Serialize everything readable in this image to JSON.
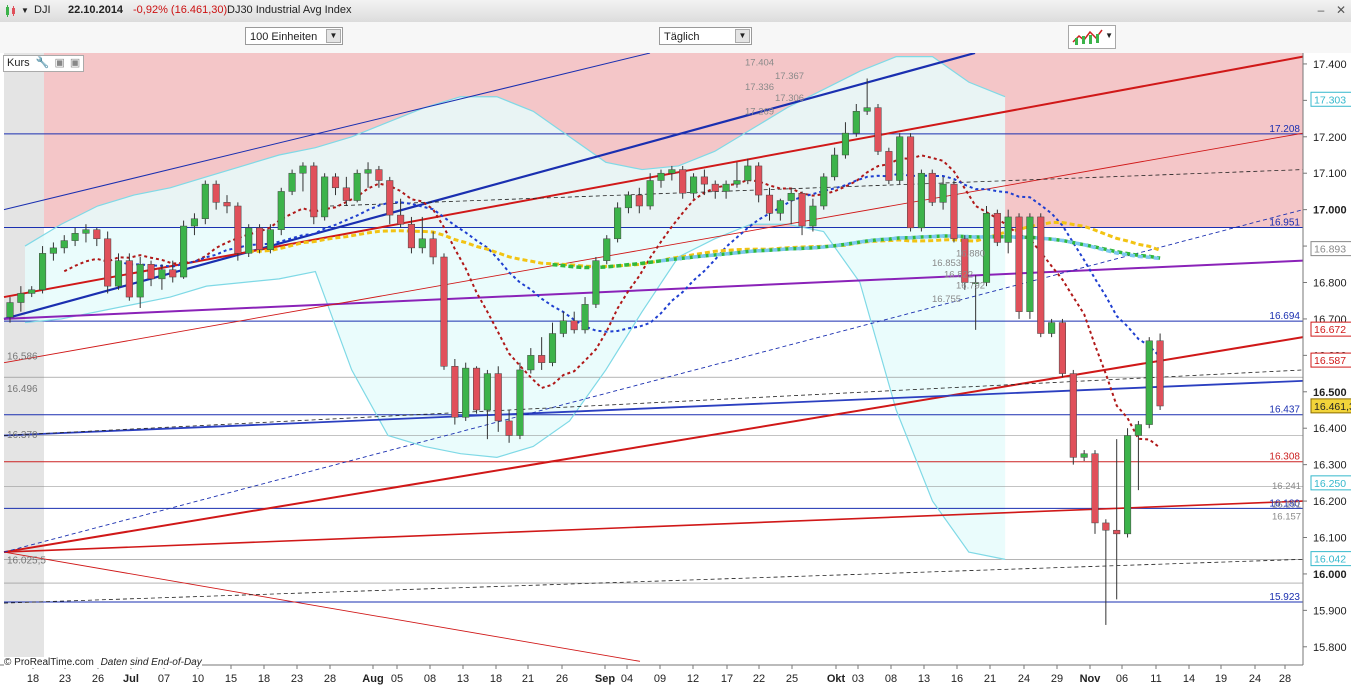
{
  "window": {
    "symbol": "DJI",
    "date": "22.10.2014",
    "change": "-0,92% (16.461,30)",
    "name": "DJ30 Industrial Avg Index"
  },
  "toolbar": {
    "units_select": "100 Einheiten",
    "period_select": "Täglich"
  },
  "panel": {
    "label": "Kurs"
  },
  "footer": {
    "copyright": "© ProRealTime.com",
    "notice": "Daten sind End-of-Day"
  },
  "colors": {
    "bull": "#3cb34a",
    "bear": "#e0505a",
    "resistance_zone": "#f4c6c8",
    "bollinger_fill": "#e6fbfb",
    "bollinger_line": "#7fd9e6",
    "price_tag": "#f2d43a"
  },
  "chart_data": {
    "type": "candlestick",
    "ylim": [
      15750,
      17430
    ],
    "y_ticks": [
      {
        "value": 17400,
        "label": "17.400"
      },
      {
        "value": 17300,
        "label": "17.300"
      },
      {
        "value": 17200,
        "label": "17.200"
      },
      {
        "value": 17100,
        "label": "17.100"
      },
      {
        "value": 17000,
        "label": "17.000"
      },
      {
        "value": 16900,
        "label": "16.900"
      },
      {
        "value": 16800,
        "label": "16.800"
      },
      {
        "value": 16700,
        "label": "16.700"
      },
      {
        "value": 16600,
        "label": "16.600"
      },
      {
        "value": 16500,
        "label": "16.500"
      },
      {
        "value": 16400,
        "label": "16.400"
      },
      {
        "value": 16300,
        "label": "16.300"
      },
      {
        "value": 16200,
        "label": "16.200"
      },
      {
        "value": 16100,
        "label": "16.100"
      },
      {
        "value": 16000,
        "label": "16.000"
      },
      {
        "value": 15900,
        "label": "15.900"
      },
      {
        "value": 15800,
        "label": "15.800"
      }
    ],
    "bold_ticks": [
      "17.000",
      "16.500",
      "16.000"
    ],
    "x_labels": [
      "18",
      "23",
      "26",
      "Jul",
      "07",
      "10",
      "15",
      "18",
      "23",
      "28",
      "Aug",
      "05",
      "08",
      "13",
      "18",
      "21",
      "26",
      "Sep",
      "04",
      "09",
      "12",
      "17",
      "22",
      "25",
      "Okt",
      "03",
      "08",
      "13",
      "16",
      "21",
      "24",
      "29",
      "Nov",
      "06",
      "11",
      "14",
      "19",
      "24",
      "28"
    ],
    "month_labels": [
      "Jul",
      "Aug",
      "Sep",
      "Okt",
      "Nov"
    ],
    "candles": [
      {
        "o": 16705,
        "h": 16760,
        "l": 16690,
        "c": 16745
      },
      {
        "o": 16745,
        "h": 16790,
        "l": 16720,
        "c": 16770
      },
      {
        "o": 16770,
        "h": 16790,
        "l": 16760,
        "c": 16780
      },
      {
        "o": 16780,
        "h": 16900,
        "l": 16770,
        "c": 16880
      },
      {
        "o": 16880,
        "h": 16910,
        "l": 16860,
        "c": 16895
      },
      {
        "o": 16895,
        "h": 16930,
        "l": 16880,
        "c": 16915
      },
      {
        "o": 16915,
        "h": 16950,
        "l": 16900,
        "c": 16935
      },
      {
        "o": 16935,
        "h": 16960,
        "l": 16910,
        "c": 16945
      },
      {
        "o": 16945,
        "h": 16950,
        "l": 16900,
        "c": 16920
      },
      {
        "o": 16920,
        "h": 16940,
        "l": 16770,
        "c": 16790
      },
      {
        "o": 16790,
        "h": 16880,
        "l": 16780,
        "c": 16860
      },
      {
        "o": 16860,
        "h": 16880,
        "l": 16750,
        "c": 16760
      },
      {
        "o": 16760,
        "h": 16870,
        "l": 16730,
        "c": 16850
      },
      {
        "o": 16850,
        "h": 16860,
        "l": 16790,
        "c": 16810
      },
      {
        "o": 16810,
        "h": 16850,
        "l": 16780,
        "c": 16835
      },
      {
        "o": 16835,
        "h": 16860,
        "l": 16800,
        "c": 16815
      },
      {
        "o": 16815,
        "h": 16970,
        "l": 16810,
        "c": 16955
      },
      {
        "o": 16955,
        "h": 16990,
        "l": 16930,
        "c": 16975
      },
      {
        "o": 16975,
        "h": 17080,
        "l": 16960,
        "c": 17070
      },
      {
        "o": 17070,
        "h": 17080,
        "l": 17000,
        "c": 17020
      },
      {
        "o": 17020,
        "h": 17040,
        "l": 16990,
        "c": 17010
      },
      {
        "o": 17010,
        "h": 17020,
        "l": 16860,
        "c": 16880
      },
      {
        "o": 16880,
        "h": 16960,
        "l": 16870,
        "c": 16950
      },
      {
        "o": 16950,
        "h": 16960,
        "l": 16880,
        "c": 16890
      },
      {
        "o": 16890,
        "h": 16960,
        "l": 16880,
        "c": 16945
      },
      {
        "o": 16945,
        "h": 17060,
        "l": 16930,
        "c": 17050
      },
      {
        "o": 17050,
        "h": 17110,
        "l": 17040,
        "c": 17100
      },
      {
        "o": 17100,
        "h": 17130,
        "l": 17050,
        "c": 17120
      },
      {
        "o": 17120,
        "h": 17130,
        "l": 16960,
        "c": 16980
      },
      {
        "o": 16980,
        "h": 17100,
        "l": 16970,
        "c": 17090
      },
      {
        "o": 17090,
        "h": 17100,
        "l": 17040,
        "c": 17060
      },
      {
        "o": 17060,
        "h": 17090,
        "l": 17010,
        "c": 17025
      },
      {
        "o": 17025,
        "h": 17110,
        "l": 17020,
        "c": 17100
      },
      {
        "o": 17100,
        "h": 17130,
        "l": 17060,
        "c": 17110
      },
      {
        "o": 17110,
        "h": 17120,
        "l": 17060,
        "c": 17080
      },
      {
        "o": 17080,
        "h": 17090,
        "l": 16960,
        "c": 16985
      },
      {
        "o": 16985,
        "h": 17030,
        "l": 16950,
        "c": 16960
      },
      {
        "o": 16960,
        "h": 16980,
        "l": 16880,
        "c": 16895
      },
      {
        "o": 16895,
        "h": 16980,
        "l": 16880,
        "c": 16920
      },
      {
        "o": 16920,
        "h": 16940,
        "l": 16850,
        "c": 16870
      },
      {
        "o": 16870,
        "h": 16880,
        "l": 16560,
        "c": 16570
      },
      {
        "o": 16570,
        "h": 16590,
        "l": 16410,
        "c": 16430
      },
      {
        "o": 16430,
        "h": 16580,
        "l": 16420,
        "c": 16565
      },
      {
        "o": 16565,
        "h": 16570,
        "l": 16440,
        "c": 16450
      },
      {
        "o": 16450,
        "h": 16560,
        "l": 16370,
        "c": 16550
      },
      {
        "o": 16550,
        "h": 16570,
        "l": 16390,
        "c": 16420
      },
      {
        "o": 16420,
        "h": 16450,
        "l": 16360,
        "c": 16380
      },
      {
        "o": 16380,
        "h": 16580,
        "l": 16370,
        "c": 16560
      },
      {
        "o": 16560,
        "h": 16620,
        "l": 16550,
        "c": 16600
      },
      {
        "o": 16600,
        "h": 16650,
        "l": 16560,
        "c": 16580
      },
      {
        "o": 16580,
        "h": 16690,
        "l": 16570,
        "c": 16660
      },
      {
        "o": 16660,
        "h": 16720,
        "l": 16650,
        "c": 16695
      },
      {
        "o": 16695,
        "h": 16720,
        "l": 16660,
        "c": 16670
      },
      {
        "o": 16670,
        "h": 16760,
        "l": 16660,
        "c": 16740
      },
      {
        "o": 16740,
        "h": 16870,
        "l": 16730,
        "c": 16860
      },
      {
        "o": 16860,
        "h": 16930,
        "l": 16850,
        "c": 16920
      },
      {
        "o": 16920,
        "h": 17020,
        "l": 16910,
        "c": 17005
      },
      {
        "o": 17005,
        "h": 17050,
        "l": 16990,
        "c": 17040
      },
      {
        "o": 17040,
        "h": 17060,
        "l": 16990,
        "c": 17010
      },
      {
        "o": 17010,
        "h": 17100,
        "l": 17000,
        "c": 17080
      },
      {
        "o": 17080,
        "h": 17110,
        "l": 17060,
        "c": 17100
      },
      {
        "o": 17100,
        "h": 17120,
        "l": 17080,
        "c": 17110
      },
      {
        "o": 17110,
        "h": 17120,
        "l": 17030,
        "c": 17045
      },
      {
        "o": 17045,
        "h": 17100,
        "l": 17030,
        "c": 17090
      },
      {
        "o": 17090,
        "h": 17110,
        "l": 17040,
        "c": 17070
      },
      {
        "o": 17070,
        "h": 17080,
        "l": 17030,
        "c": 17050
      },
      {
        "o": 17050,
        "h": 17080,
        "l": 17030,
        "c": 17070
      },
      {
        "o": 17070,
        "h": 17130,
        "l": 17060,
        "c": 17080
      },
      {
        "o": 17080,
        "h": 17140,
        "l": 17070,
        "c": 17120
      },
      {
        "o": 17120,
        "h": 17130,
        "l": 17020,
        "c": 17040
      },
      {
        "o": 17040,
        "h": 17060,
        "l": 16970,
        "c": 16990
      },
      {
        "o": 16990,
        "h": 17030,
        "l": 16970,
        "c": 17025
      },
      {
        "o": 17025,
        "h": 17060,
        "l": 16960,
        "c": 17045
      },
      {
        "o": 17045,
        "h": 17050,
        "l": 16930,
        "c": 16955
      },
      {
        "o": 16955,
        "h": 17030,
        "l": 16940,
        "c": 17010
      },
      {
        "o": 17010,
        "h": 17100,
        "l": 17000,
        "c": 17090
      },
      {
        "o": 17090,
        "h": 17170,
        "l": 17080,
        "c": 17150
      },
      {
        "o": 17150,
        "h": 17240,
        "l": 17140,
        "c": 17210
      },
      {
        "o": 17210,
        "h": 17290,
        "l": 17200,
        "c": 17270
      },
      {
        "o": 17270,
        "h": 17360,
        "l": 17260,
        "c": 17280
      },
      {
        "o": 17280,
        "h": 17290,
        "l": 17150,
        "c": 17160
      },
      {
        "o": 17160,
        "h": 17170,
        "l": 17070,
        "c": 17080
      },
      {
        "o": 17080,
        "h": 17210,
        "l": 17070,
        "c": 17200
      },
      {
        "o": 17200,
        "h": 17210,
        "l": 16940,
        "c": 16950
      },
      {
        "o": 16950,
        "h": 17110,
        "l": 16940,
        "c": 17100
      },
      {
        "o": 17100,
        "h": 17110,
        "l": 17010,
        "c": 17020
      },
      {
        "o": 17020,
        "h": 17090,
        "l": 17000,
        "c": 17070
      },
      {
        "o": 17070,
        "h": 17080,
        "l": 16910,
        "c": 16920
      },
      {
        "o": 16920,
        "h": 16930,
        "l": 16780,
        "c": 16800
      },
      {
        "o": 16800,
        "h": 16820,
        "l": 16670,
        "c": 16800
      },
      {
        "o": 16800,
        "h": 17010,
        "l": 16790,
        "c": 16990
      },
      {
        "o": 16990,
        "h": 17000,
        "l": 16900,
        "c": 16910
      },
      {
        "o": 16910,
        "h": 17000,
        "l": 16880,
        "c": 16980
      },
      {
        "o": 16980,
        "h": 16990,
        "l": 16700,
        "c": 16720
      },
      {
        "o": 16720,
        "h": 16990,
        "l": 16700,
        "c": 16980
      },
      {
        "o": 16980,
        "h": 16990,
        "l": 16650,
        "c": 16660
      },
      {
        "o": 16660,
        "h": 16700,
        "l": 16650,
        "c": 16690
      },
      {
        "o": 16690,
        "h": 16700,
        "l": 16540,
        "c": 16550
      },
      {
        "o": 16550,
        "h": 16560,
        "l": 16300,
        "c": 16320
      },
      {
        "o": 16320,
        "h": 16340,
        "l": 16310,
        "c": 16330
      },
      {
        "o": 16330,
        "h": 16340,
        "l": 16110,
        "c": 16140
      },
      {
        "o": 16140,
        "h": 16150,
        "l": 15860,
        "c": 16120
      },
      {
        "o": 16120,
        "h": 16370,
        "l": 15930,
        "c": 16110
      },
      {
        "o": 16110,
        "h": 16400,
        "l": 16100,
        "c": 16380
      },
      {
        "o": 16380,
        "h": 16420,
        "l": 16230,
        "c": 16410
      },
      {
        "o": 16410,
        "h": 16650,
        "l": 16400,
        "c": 16640
      },
      {
        "o": 16640,
        "h": 16660,
        "l": 16450,
        "c": 16461
      }
    ],
    "level_lines": [
      {
        "value": 17208,
        "label": "17.208",
        "color": "#1a2fb0"
      },
      {
        "value": 16951,
        "label": "16.951",
        "color": "#1a2fb0"
      },
      {
        "value": 16694,
        "label": "16.694",
        "color": "#1a2fb0"
      },
      {
        "value": 16437,
        "label": "16.437",
        "color": "#1a2fb0"
      },
      {
        "value": 16308,
        "label": "16.308",
        "color": "#cc2222"
      },
      {
        "value": 16180,
        "label": "16.180",
        "color": "#1a2fb0"
      },
      {
        "value": 15923,
        "label": "15.923",
        "color": "#1a2fb0"
      }
    ],
    "left_labels": [
      {
        "value": 16586,
        "label": "16.586"
      },
      {
        "value": 16496,
        "label": "16.496"
      },
      {
        "value": 16370,
        "label": "16.370"
      },
      {
        "value": 16025.5,
        "label": "16.025,5"
      }
    ],
    "right_tags": [
      {
        "value": 17303,
        "label": "17.303",
        "style": "cyan"
      },
      {
        "value": 16893,
        "label": "16.893",
        "style": "gray"
      },
      {
        "value": 16672,
        "label": "16.672",
        "style": "red"
      },
      {
        "value": 16587,
        "label": "16.587",
        "style": "red"
      },
      {
        "value": 16461.3,
        "label": "16.461,3",
        "style": "price"
      },
      {
        "value": 16250,
        "label": "16.250",
        "style": "cyan"
      },
      {
        "value": 16042,
        "label": "16.042",
        "style": "cyan"
      }
    ],
    "fib_labels": [
      {
        "value": 17404,
        "label": "17.404"
      },
      {
        "value": 17367,
        "label": "17.367"
      },
      {
        "value": 17336,
        "label": "17.336"
      },
      {
        "value": 17306,
        "label": "17.306"
      },
      {
        "value": 17269,
        "label": "17.269"
      },
      {
        "value": 16880,
        "label": "16.880"
      },
      {
        "value": 16853,
        "label": "16.853"
      },
      {
        "value": 16822,
        "label": "16.822"
      },
      {
        "value": 16792,
        "label": "16.792"
      },
      {
        "value": 16755,
        "label": "16.755"
      },
      {
        "value": 16241,
        "label": "16.241"
      },
      {
        "value": 16191,
        "label": "16.191"
      },
      {
        "value": 16157,
        "label": "16.157"
      }
    ]
  }
}
